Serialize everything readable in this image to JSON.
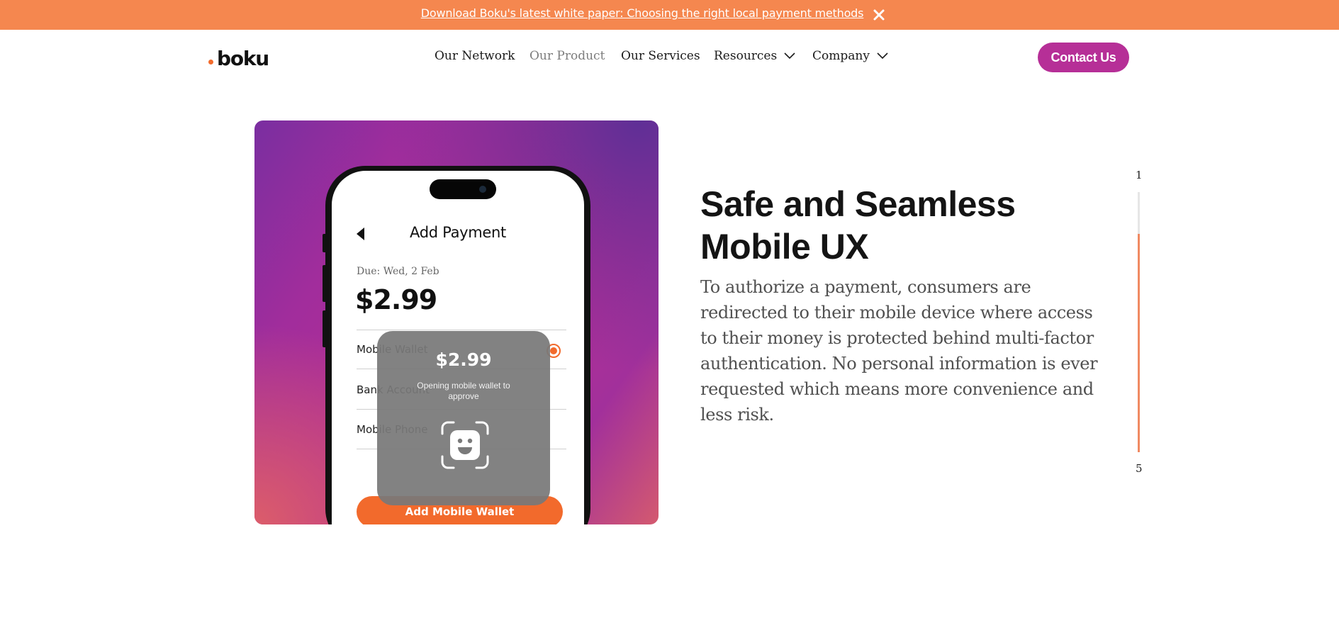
{
  "banner": {
    "link_text": "Download Boku's latest white paper: Choosing the right local payment methods",
    "close_icon": "close-icon"
  },
  "header": {
    "logo_text": "boku",
    "nav": [
      {
        "label": "Our Network",
        "has_dropdown": false,
        "active": false
      },
      {
        "label": "Our Product",
        "has_dropdown": false,
        "active": true
      },
      {
        "label": "Our Services",
        "has_dropdown": false,
        "active": false
      },
      {
        "label": "Resources",
        "has_dropdown": true,
        "active": false
      },
      {
        "label": "Company",
        "has_dropdown": true,
        "active": false
      }
    ],
    "contact_label": "Contact Us"
  },
  "phone": {
    "title": "Add Payment",
    "due": "Due: Wed, 2 Feb",
    "amount": "$2.99",
    "options": [
      "Mobile Wallet",
      "Bank Account",
      "Mobile Phone"
    ],
    "selected_option": "Mobile Wallet",
    "cta": "Add Mobile Wallet",
    "overlay": {
      "amount": "$2.99",
      "message": "Opening mobile wallet to approve",
      "icon": "face-id-icon"
    }
  },
  "content": {
    "headline": "Safe and Seamless Mobile UX",
    "body": "To authorize a payment, consumers are redirected to their mobile device where access to their money is protected behind multi-factor authentication. No personal information is ever requested which means more convenience and less risk."
  },
  "progress": {
    "start_label": "1",
    "end_label": "5",
    "fill_fraction": 0.84
  },
  "colors": {
    "banner": "#f5874f",
    "brand_magenta": "#b62f97",
    "accent_orange": "#f26a2c",
    "progress_fill": "#f08a62"
  }
}
